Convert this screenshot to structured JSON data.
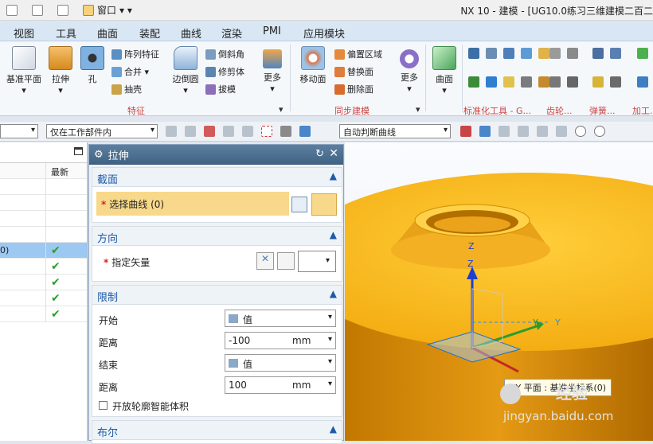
{
  "titlebar": {
    "window_menu": "窗口",
    "title": "NX 10 - 建模 - [UG10.0练习三维建模二百二"
  },
  "menubar": {
    "items": [
      "视图",
      "工具",
      "曲面",
      "装配",
      "曲线",
      "渲染",
      "PMI",
      "应用模块"
    ]
  },
  "ribbon": {
    "feature": {
      "datum_plane": "基准平面",
      "extrude": "拉伸",
      "hole": "孔",
      "edge_blend": "边倒圆",
      "more": "更多",
      "pattern": "阵列特征",
      "unite": "合并",
      "shell": "抽壳",
      "chamfer": "倒斜角",
      "trim_body": "修剪体",
      "draft": "拔模",
      "label": "特征"
    },
    "sync": {
      "move_face": "移动面",
      "offset_region": "偏置区域",
      "replace_face": "替换面",
      "delete_face": "删除面",
      "more": "更多",
      "label": "同步建模"
    },
    "surface": {
      "surface": "曲面"
    },
    "std_label": "标准化工具 - G...",
    "gear_label": "齿轮...",
    "spring_label": "弹簧...",
    "machine_label": "加工..."
  },
  "filterbar": {
    "selection_scope": "仅在工作部件内",
    "curve_rule": "自动判断曲线"
  },
  "navigator": {
    "col_latest": "最新",
    "selected_fragment": "0)",
    "check_rows": 5
  },
  "dialog": {
    "title": "拉伸",
    "section": {
      "header": "截面",
      "select_curve": "选择曲线 (0)"
    },
    "direction": {
      "header": "方向",
      "specify_vector": "指定矢量"
    },
    "limits": {
      "header": "限制",
      "start_label": "开始",
      "start_value": "值",
      "distance1_label": "距离",
      "distance1_value": "-100",
      "unit1": "mm",
      "end_label": "结束",
      "end_value": "值",
      "distance2_label": "距离",
      "distance2_value": "100",
      "unit2": "mm",
      "open_profile": "开放轮廓智能体积"
    },
    "boolean": {
      "header": "布尔"
    }
  },
  "viewport": {
    "axis_z": "Z",
    "axis_y": "Y",
    "csys_label": "XY 平面 : 基准坐标系(0)"
  },
  "watermark": {
    "brand": "经验",
    "url": "jingyan.baidu.com"
  }
}
